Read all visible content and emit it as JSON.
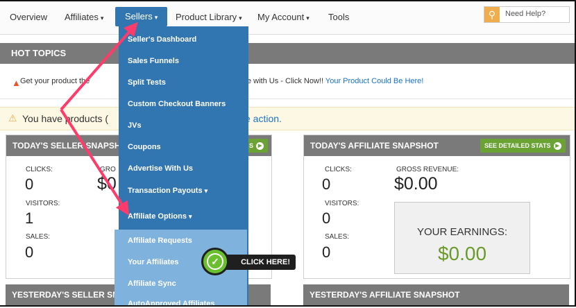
{
  "nav": {
    "overview": "Overview",
    "affiliates": "Affiliates",
    "sellers": "Sellers",
    "product_library": "Product Library",
    "my_account": "My Account",
    "tools": "Tools",
    "caret": "▾",
    "help_placeholder": "Need Help?",
    "help_icon": "search-icon"
  },
  "hot_topics": {
    "title": "HOT TOPICS",
    "line_start": "Get your product the",
    "line_end": "e with Us - Click Now!!",
    "link": "Your Product Could Be Here!"
  },
  "alert": {
    "text_start": "You have products (",
    "text_end": "e action."
  },
  "seller_today": {
    "title": "TODAY'S SELLER SNAPSH",
    "btn_tail": "S",
    "clicks_label": "CLICKS:",
    "clicks": "0",
    "gross_label_part": "GRO",
    "gross_part": "$0",
    "visitors_label": "VISITORS:",
    "visitors": "1",
    "sales_label": "SALES:",
    "sales": "0"
  },
  "affiliate_today": {
    "title": "TODAY'S AFFILIATE SNAPSHOT",
    "btn": "SEE DETAILED STATS",
    "clicks_label": "CLICKS:",
    "clicks": "0",
    "gross_label": "GROSS REVENUE:",
    "gross": "$0.00",
    "visitors_label": "VISITORS:",
    "visitors": "0",
    "sales_label": "SALES:",
    "sales": "0",
    "earnings_label": "YOUR EARNINGS:",
    "earnings": "$0.00"
  },
  "yesterday": {
    "seller": "YESTERDAY'S SELLER SNA",
    "affiliate": "YESTERDAY'S AFFILIATE SNAPSHOT"
  },
  "sellers_menu": [
    "Seller's Dashboard",
    "Sales Funnels",
    "Split Tests",
    "Custom Checkout Banners",
    "JVs",
    "Coupons",
    "Advertise With Us",
    "Transaction Payouts",
    "Affiliate Options"
  ],
  "affiliate_submenu": [
    "Affiliate Requests",
    "Your Affiliates",
    "Affiliate Sync",
    "AutoApproved Affiliates"
  ],
  "callout": "CLICK HERE!",
  "colors": {
    "nav_active": "#3276b1",
    "submenu": "#7fb2dc",
    "arrow": "#ff3b6b",
    "success": "#6aa234"
  }
}
